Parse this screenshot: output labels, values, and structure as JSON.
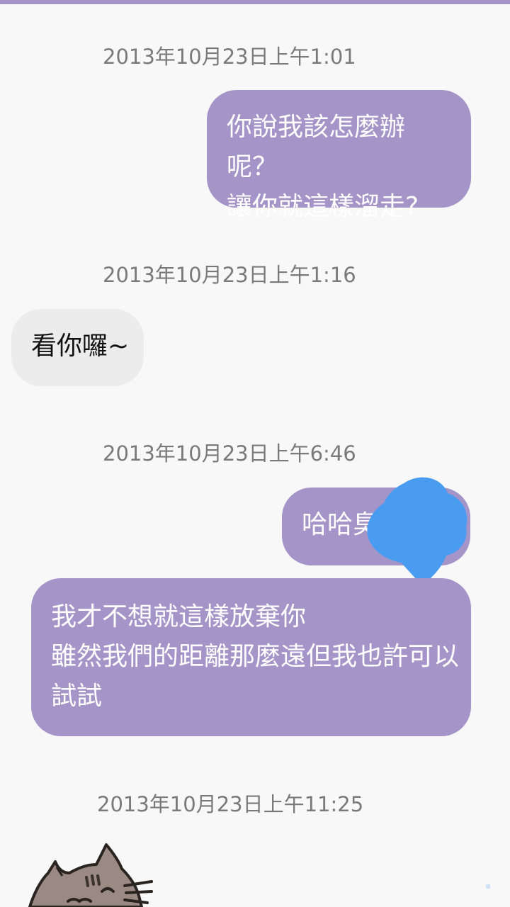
{
  "messages": {
    "ts1": "2013年10月23日上午1:01",
    "msg1": "你說我該怎麼辦呢？\n讓你就這樣溜走?",
    "ts2": "2013年10月23日上午1:16",
    "msg2": "看你囉~",
    "ts3": "2013年10月23日上午6:46",
    "msg3": "哈哈臭",
    "msg4": "我才不想就這樣放棄你\n雖然我們的距離那麼遠但我也許可以\n試試",
    "ts4": "2013年10月23日上午11:25"
  },
  "sticker": {
    "icon": "pusheen-cat-sticker-icon"
  },
  "colors": {
    "outgoing_bubble": "#a594c8",
    "incoming_bubble": "#ececec",
    "background": "#f8f8f9",
    "redaction": "#4a9cf0"
  }
}
